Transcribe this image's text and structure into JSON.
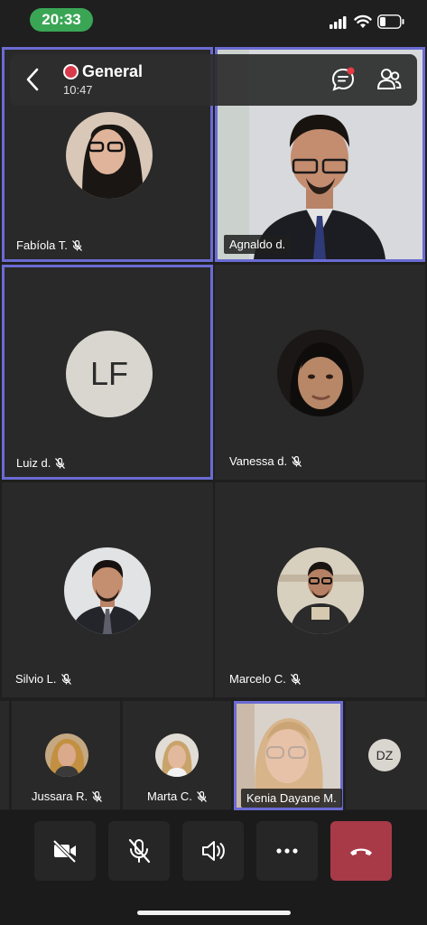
{
  "status_bar": {
    "time": "20:33"
  },
  "header": {
    "title": "General",
    "elapsed": "10:47"
  },
  "grid": {
    "fabiola": {
      "name": "Fabíola T."
    },
    "agnaldo": {
      "name": "Agnaldo d."
    },
    "luiz": {
      "name": "Luiz d.",
      "initials": "LF"
    },
    "vanessa": {
      "name": "Vanessa d."
    },
    "silvio": {
      "name": "Silvio L."
    },
    "marcelo": {
      "name": "Marcelo C."
    }
  },
  "strip": {
    "jussara": {
      "name": "Jussara R."
    },
    "marta": {
      "name": "Marta C."
    },
    "kenia": {
      "name": "Kenia Dayane M."
    },
    "dz": {
      "initials": "DZ"
    }
  },
  "toolbar": {
    "buttons": [
      "camera-off",
      "mic-off",
      "speaker",
      "more",
      "hang-up"
    ]
  },
  "colors": {
    "accent_border": "#6b6bd3",
    "recording": "#d8394b",
    "hang_up": "#a83a48",
    "time_pill": "#3aa655"
  }
}
